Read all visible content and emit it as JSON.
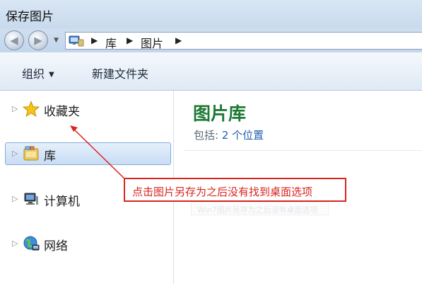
{
  "window": {
    "title": "保存图片"
  },
  "navigation": {
    "back_icon": "back-arrow-icon",
    "forward_icon": "forward-arrow-icon",
    "dropdown_icon": "chevron-down-icon",
    "path": [
      "库",
      "图片"
    ],
    "path_separator": "▶"
  },
  "toolbar": {
    "organize_label": "组织",
    "new_folder_label": "新建文件夹"
  },
  "sidebar": {
    "items": [
      {
        "label": "收藏夹",
        "icon": "star-icon"
      },
      {
        "label": "库",
        "icon": "library-icon",
        "selected": true
      },
      {
        "label": "计算机",
        "icon": "computer-icon"
      },
      {
        "label": "网络",
        "icon": "network-icon"
      }
    ]
  },
  "main": {
    "library_title": "图片库",
    "includes_label": "包括:",
    "locations_link": "2 个位置"
  },
  "annotation": {
    "callout_text": "点击图片另存为之后没有找到桌面选项",
    "watermark_text": "Win7图片另存为之后没有桌面选项",
    "color": "#d8251f"
  }
}
